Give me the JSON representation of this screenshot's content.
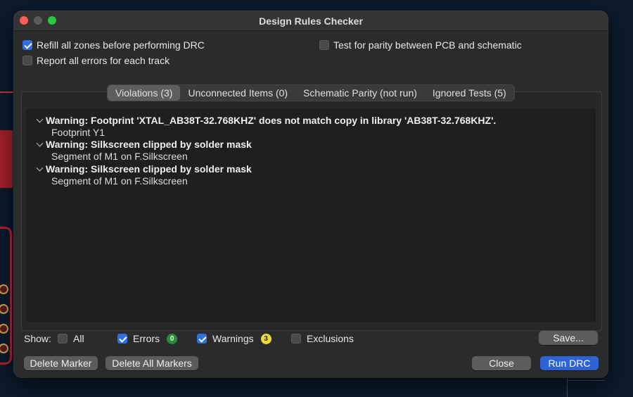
{
  "dialog": {
    "title": "Design Rules Checker"
  },
  "options": {
    "refill_zones": {
      "label": "Refill all zones before performing DRC",
      "checked": true
    },
    "report_all_errors": {
      "label": "Report all errors for each track",
      "checked": false
    },
    "test_parity": {
      "label": "Test for parity between PCB and schematic",
      "checked": false
    }
  },
  "tabs": [
    {
      "label": "Violations (3)",
      "active": true
    },
    {
      "label": "Unconnected Items (0)",
      "active": false
    },
    {
      "label": "Schematic Parity (not run)",
      "active": false
    },
    {
      "label": "Ignored Tests (5)",
      "active": false
    }
  ],
  "violations": [
    {
      "title": "Warning: Footprint 'XTAL_AB38T-32.768KHZ' does not match copy in library 'AB38T-32.768KHZ'.",
      "detail": "Footprint Y1"
    },
    {
      "title": "Warning: Silkscreen clipped by solder mask",
      "detail": "Segment of M1 on F.Silkscreen"
    },
    {
      "title": "Warning: Silkscreen clipped by solder mask",
      "detail": "Segment of M1 on F.Silkscreen"
    }
  ],
  "filters": {
    "show_label": "Show:",
    "all": {
      "label": "All",
      "checked": false
    },
    "errors": {
      "label": "Errors",
      "checked": true,
      "count": "0"
    },
    "warnings": {
      "label": "Warnings",
      "checked": true,
      "count": "3"
    },
    "exclusions": {
      "label": "Exclusions",
      "checked": false
    }
  },
  "buttons": {
    "save": "Save...",
    "delete_marker": "Delete Marker",
    "delete_all_markers": "Delete All Markers",
    "close": "Close",
    "run_drc": "Run DRC"
  },
  "colors": {
    "accent": "#2e63d6",
    "errors_badge": "#2d8a3a",
    "warnings_badge": "#f2d93a"
  }
}
